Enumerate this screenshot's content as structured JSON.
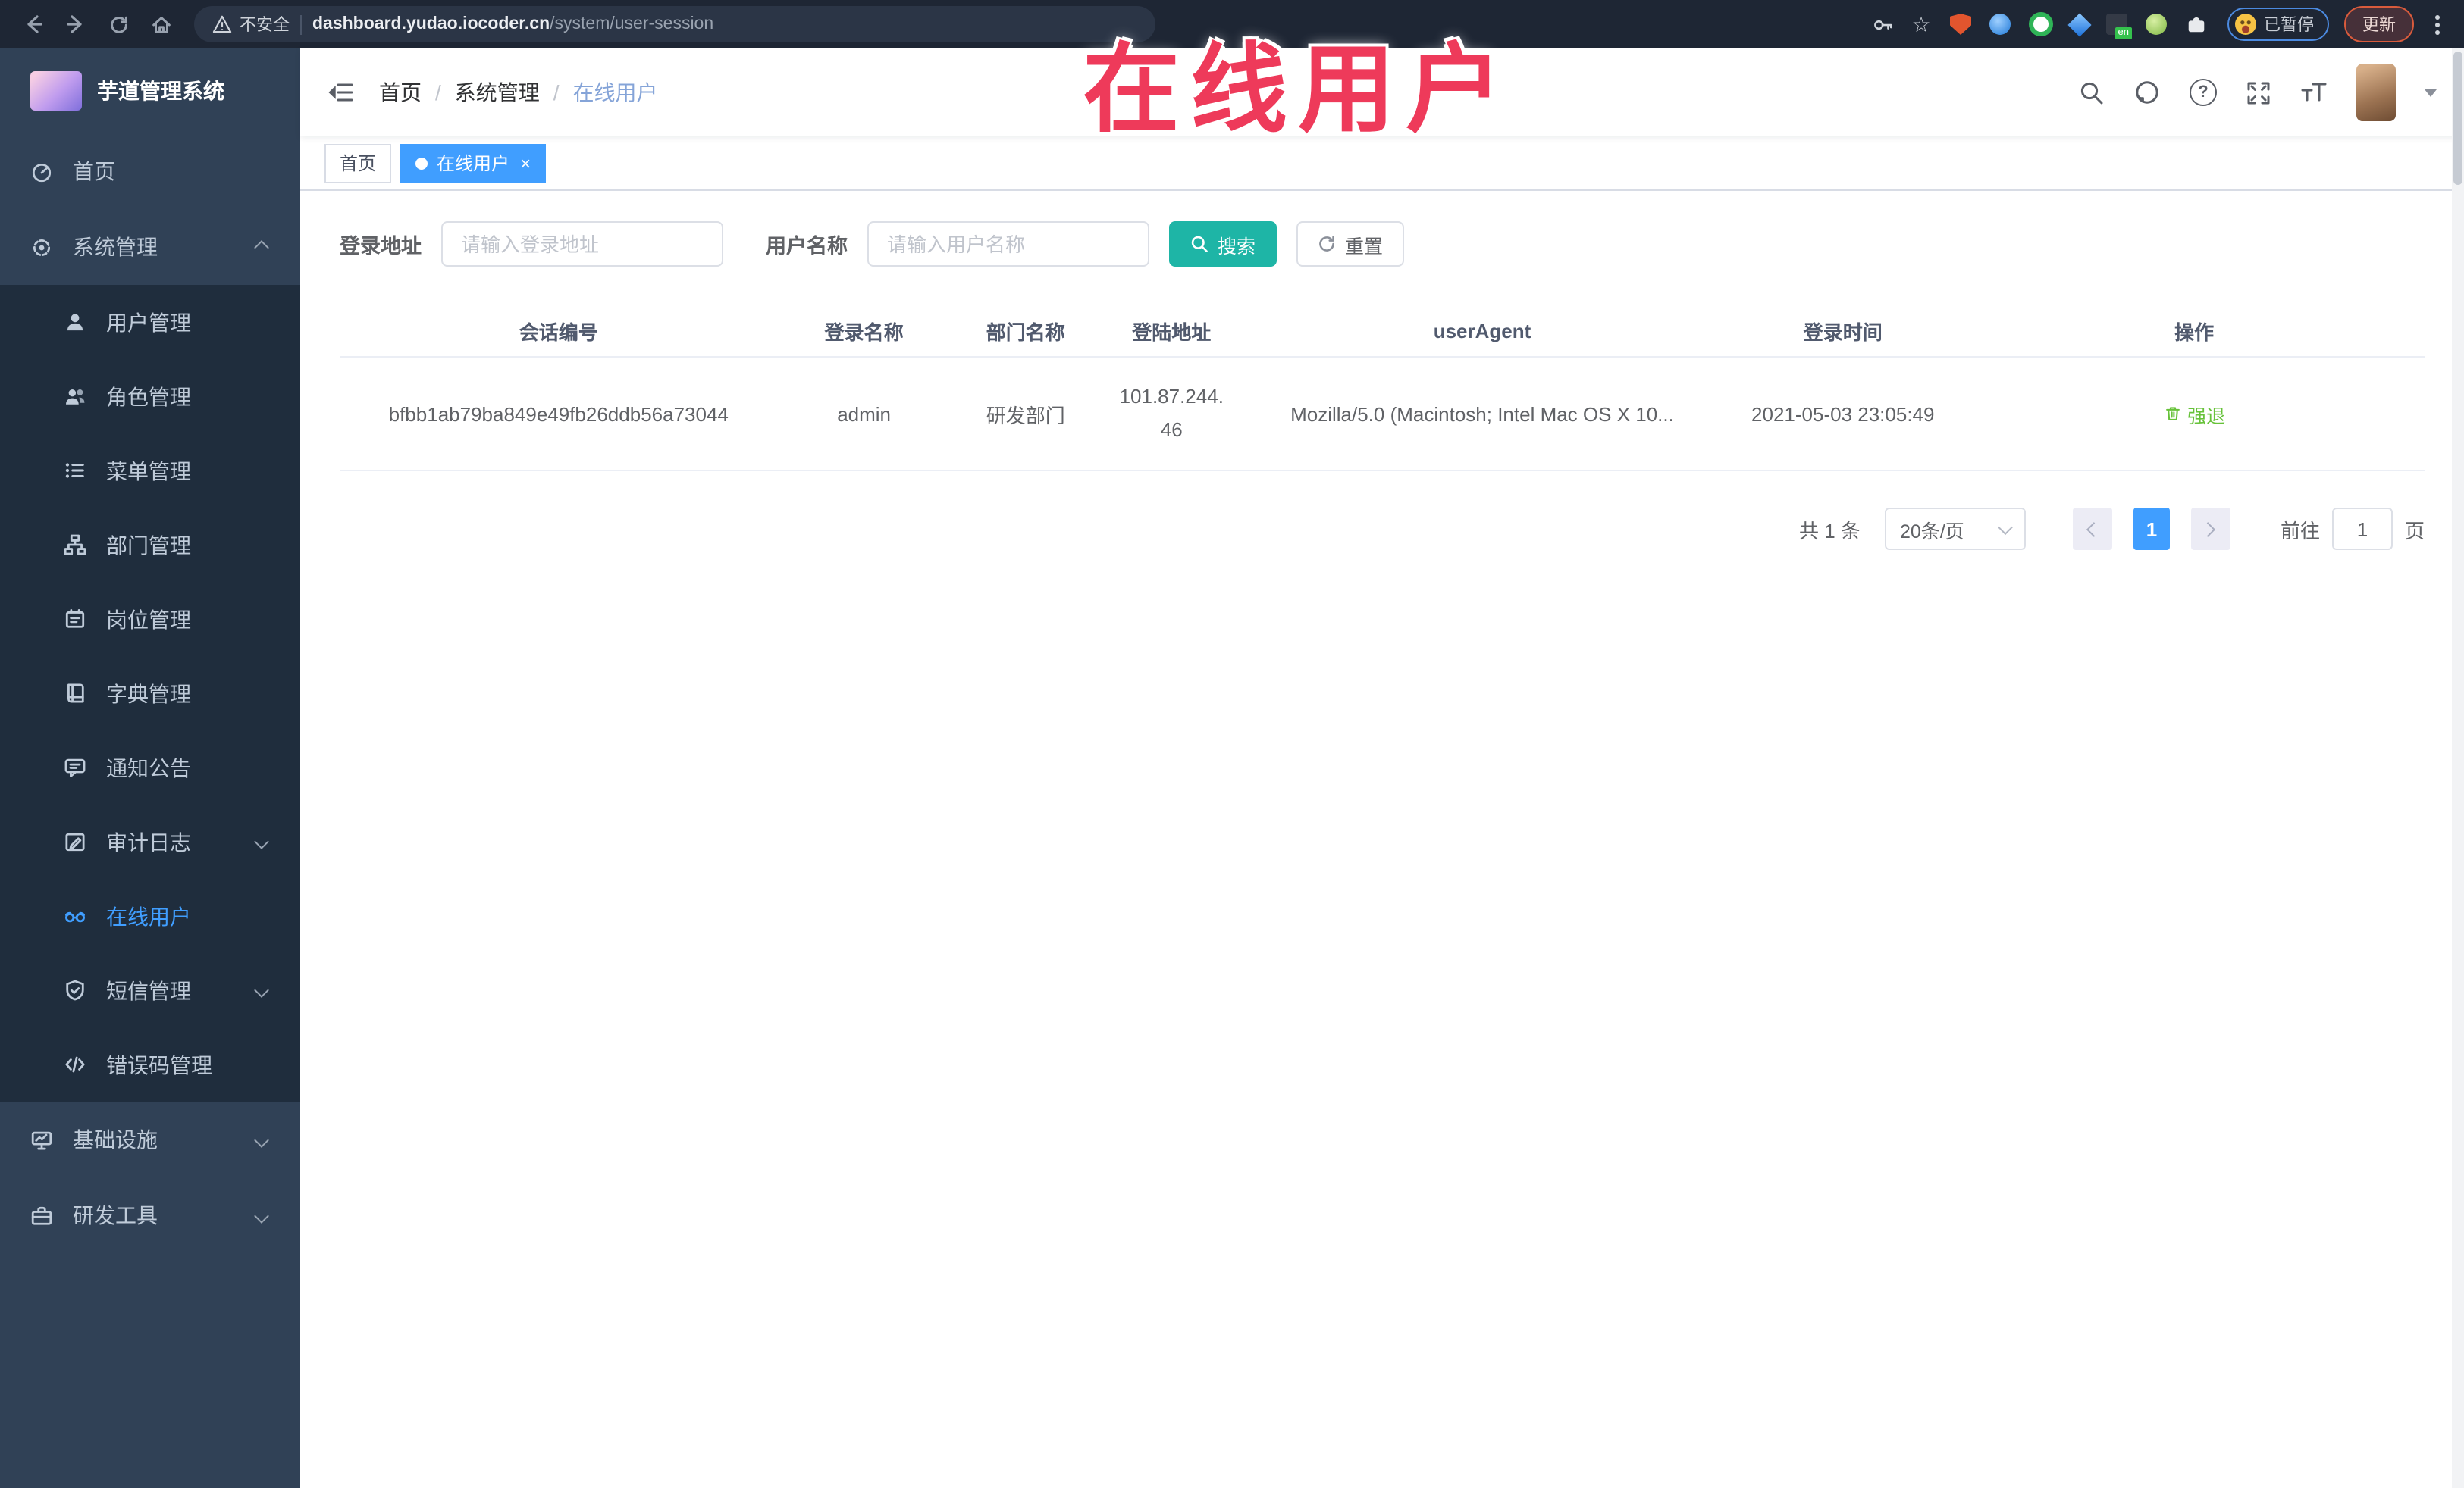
{
  "browser": {
    "security_label": "不安全",
    "url_host": "dashboard.yudao.iocoder.cn",
    "url_path": "/system/user-session",
    "star_glyph": "☆",
    "extension_badge": "en",
    "paused_label": "已暂停",
    "update_label": "更新"
  },
  "overlay": {
    "text": "在线用户"
  },
  "sidebar": {
    "app_title": "芋道管理系统",
    "items": [
      {
        "label": "首页"
      },
      {
        "label": "系统管理",
        "expanded": true
      },
      {
        "label": "用户管理"
      },
      {
        "label": "角色管理"
      },
      {
        "label": "菜单管理"
      },
      {
        "label": "部门管理"
      },
      {
        "label": "岗位管理"
      },
      {
        "label": "字典管理"
      },
      {
        "label": "通知公告"
      },
      {
        "label": "审计日志",
        "collapsible": true
      },
      {
        "label": "在线用户",
        "active": true
      },
      {
        "label": "短信管理",
        "collapsible": true
      },
      {
        "label": "错误码管理"
      },
      {
        "label": "基础设施",
        "collapsible": true
      },
      {
        "label": "研发工具",
        "collapsible": true
      }
    ]
  },
  "header": {
    "breadcrumb": [
      "首页",
      "系统管理",
      "在线用户"
    ],
    "separator": "/",
    "help_glyph": "?"
  },
  "tags": {
    "items": [
      {
        "label": "首页"
      },
      {
        "label": "在线用户",
        "active": true
      }
    ],
    "close_glyph": "×"
  },
  "filters": {
    "login_address_label": "登录地址",
    "login_address_placeholder": "请输入登录地址",
    "username_label": "用户名称",
    "username_placeholder": "请输入用户名称",
    "search_label": "搜索",
    "reset_label": "重置"
  },
  "table": {
    "columns": [
      "会话编号",
      "登录名称",
      "部门名称",
      "登陆地址",
      "userAgent",
      "登录时间",
      "操作"
    ],
    "rows": [
      {
        "session_id": "bfbb1ab79ba849e49fb26ddb56a73044",
        "username": "admin",
        "dept": "研发部门",
        "ip": "101.87.244.46",
        "user_agent": "Mozilla/5.0 (Macintosh; Intel Mac OS X 10...",
        "login_time": "2021-05-03 23:05:49",
        "action": "强退"
      }
    ]
  },
  "pagination": {
    "total": "共 1 条",
    "page_size": "20条/页",
    "current_page": "1",
    "goto_label": "前往",
    "goto_value": "1",
    "unit_label": "页"
  },
  "theme": {
    "accent": "#409eff",
    "search_button": "#1eb5a6",
    "action_link": "#67c23a",
    "overlay_red": "#ee3a5a",
    "sidebar_bg": "#304156",
    "submenu_bg": "#1f2d3d",
    "browser_bar": "#1e2634"
  }
}
